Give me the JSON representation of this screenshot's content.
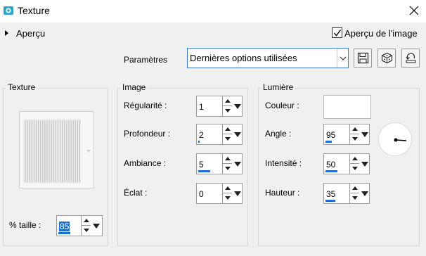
{
  "window": {
    "title": "Texture",
    "icon": "paint-app-icon",
    "close_icon": "close-icon"
  },
  "preview": {
    "section_label": "Aperçu",
    "checkbox_label": "Aperçu de l'image",
    "checkbox_checked": true
  },
  "params": {
    "label": "Paramètres",
    "preset_value": "Dernières options utilisées",
    "buttons": [
      {
        "name": "save-preset-button",
        "icon": "save-icon"
      },
      {
        "name": "random-button",
        "icon": "dice-icon"
      },
      {
        "name": "reset-button",
        "icon": "reset-icon"
      }
    ]
  },
  "texture": {
    "title": "Texture",
    "size_label": "% taille :",
    "size_value": "85",
    "size_fraction": 0.5
  },
  "image": {
    "title": "Image",
    "fields": [
      {
        "label": "Régularité :",
        "value": "1",
        "fraction": 0.0
      },
      {
        "label": "Profondeur :",
        "value": "2",
        "fraction": 0.05
      },
      {
        "label": "Ambiance :",
        "value": "5",
        "fraction": 0.5
      },
      {
        "label": "Éclat :",
        "value": "0",
        "fraction": 0.0
      }
    ]
  },
  "light": {
    "title": "Lumière",
    "color_label": "Couleur :",
    "color_value": "#ffffff",
    "fields": [
      {
        "label": "Angle :",
        "value": "95",
        "fraction": 0.27
      },
      {
        "label": "Intensité :",
        "value": "50",
        "fraction": 0.5
      },
      {
        "label": "Hauteur :",
        "value": "35",
        "fraction": 0.4
      }
    ]
  },
  "colors": {
    "accent": "#1f6fd1",
    "background": "#f0f0f0",
    "app_icon": "#2aa7c9"
  }
}
